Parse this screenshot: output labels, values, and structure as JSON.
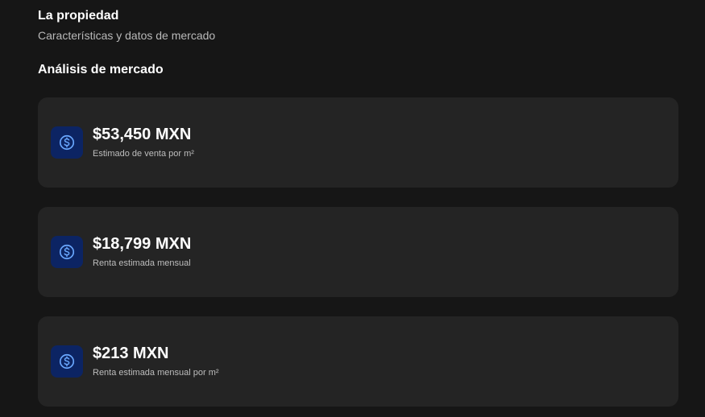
{
  "header": {
    "title": "La propiedad",
    "subtitle": "Características y datos de mercado"
  },
  "market": {
    "title": "Análisis de mercado",
    "cards": [
      {
        "value": "$53,450 MXN",
        "label": "Estimado de venta por m²",
        "icon": "dollar-coin-icon"
      },
      {
        "value": "$18,799 MXN",
        "label": "Renta estimada mensual",
        "icon": "dollar-coin-icon"
      },
      {
        "value": "$213 MXN",
        "label": "Renta estimada mensual por m²",
        "icon": "dollar-coin-icon"
      }
    ]
  },
  "colors": {
    "background": "#161616",
    "card": "#242424",
    "icon_bg": "#0c2463",
    "icon_stroke": "#6aa8ff"
  }
}
